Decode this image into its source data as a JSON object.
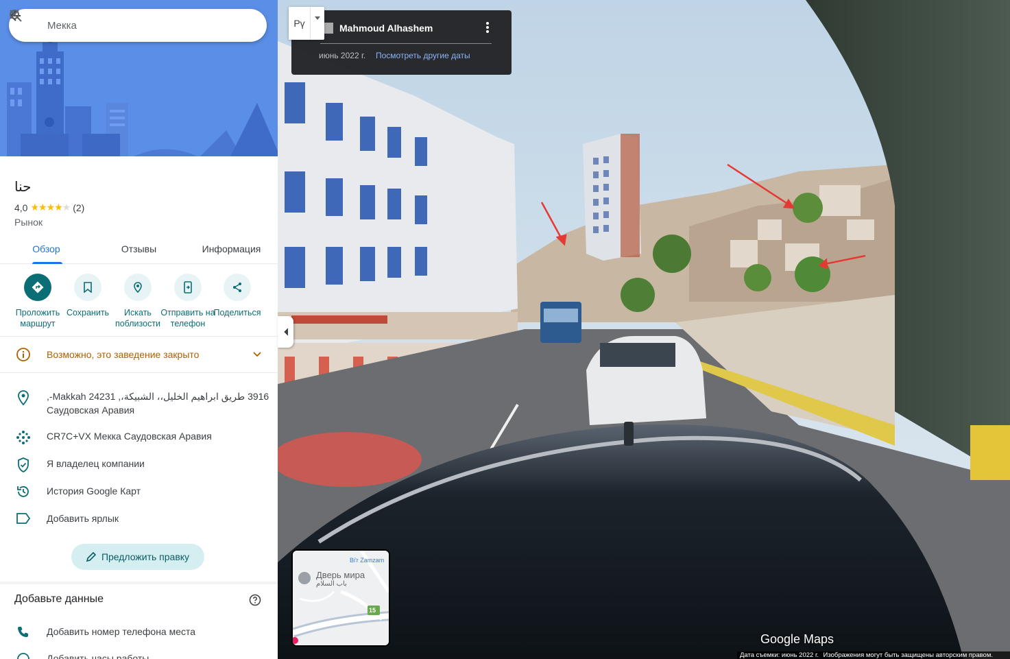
{
  "search": {
    "query": "Мекка"
  },
  "place": {
    "name": "حنا",
    "rating": "4,0",
    "rating_value": 4.0,
    "reviews": "(2)",
    "category": "Рынок"
  },
  "tabs": [
    {
      "label": "Обзор",
      "active": true
    },
    {
      "label": "Отзывы",
      "active": false
    },
    {
      "label": "Информация",
      "active": false
    }
  ],
  "actions": [
    {
      "label": "Проложить маршрут",
      "icon": "directions-icon"
    },
    {
      "label": "Сохранить",
      "icon": "bookmark-icon"
    },
    {
      "label": "Искать поблизости",
      "icon": "nearby-icon"
    },
    {
      "label": "Отправить на телефон",
      "icon": "send-to-phone-icon"
    },
    {
      "label": "Поделиться",
      "icon": "share-icon"
    }
  ],
  "notice": {
    "text": "Возможно, это заведение закрыто",
    "color": "#b06000"
  },
  "info": {
    "address_line1": "3916 طريق ابراهيم الخليل،، الشبيكة،, Makkah 24231-,",
    "address_line2": "Саудовская Аравия",
    "plus_code": "CR7C+VX Мекка Саудовская Аравия",
    "claim": "Я владелец компании",
    "history": "История Google Карт",
    "label": "Добавить ярлык"
  },
  "suggest_edit": "Предложить правку",
  "add_data": {
    "title": "Добавьте данные",
    "items": [
      "Добавить номер телефона места",
      "Добавить часы работы"
    ]
  },
  "street_view": {
    "lang_button": "Рү",
    "author": "Mahmoud Alhashem",
    "date": "июнь 2022 г.",
    "more_dates": "Посмотреть другие даты",
    "minimap_poi": "Дверь мира",
    "minimap_poi_ar": "باب السلام",
    "minimap_well": "Bi'r Zamzam",
    "minimap_route": "15",
    "logo": "Google Maps",
    "footer_date": "Дата съемки: июнь 2022 г.",
    "footer_copyright": "Изображения могут быть защищены авторским правом."
  },
  "colors": {
    "accent": "#1a73e8",
    "teal": "#0b6e75",
    "warning": "#b06000",
    "annotation_arrow": "#e53935"
  }
}
